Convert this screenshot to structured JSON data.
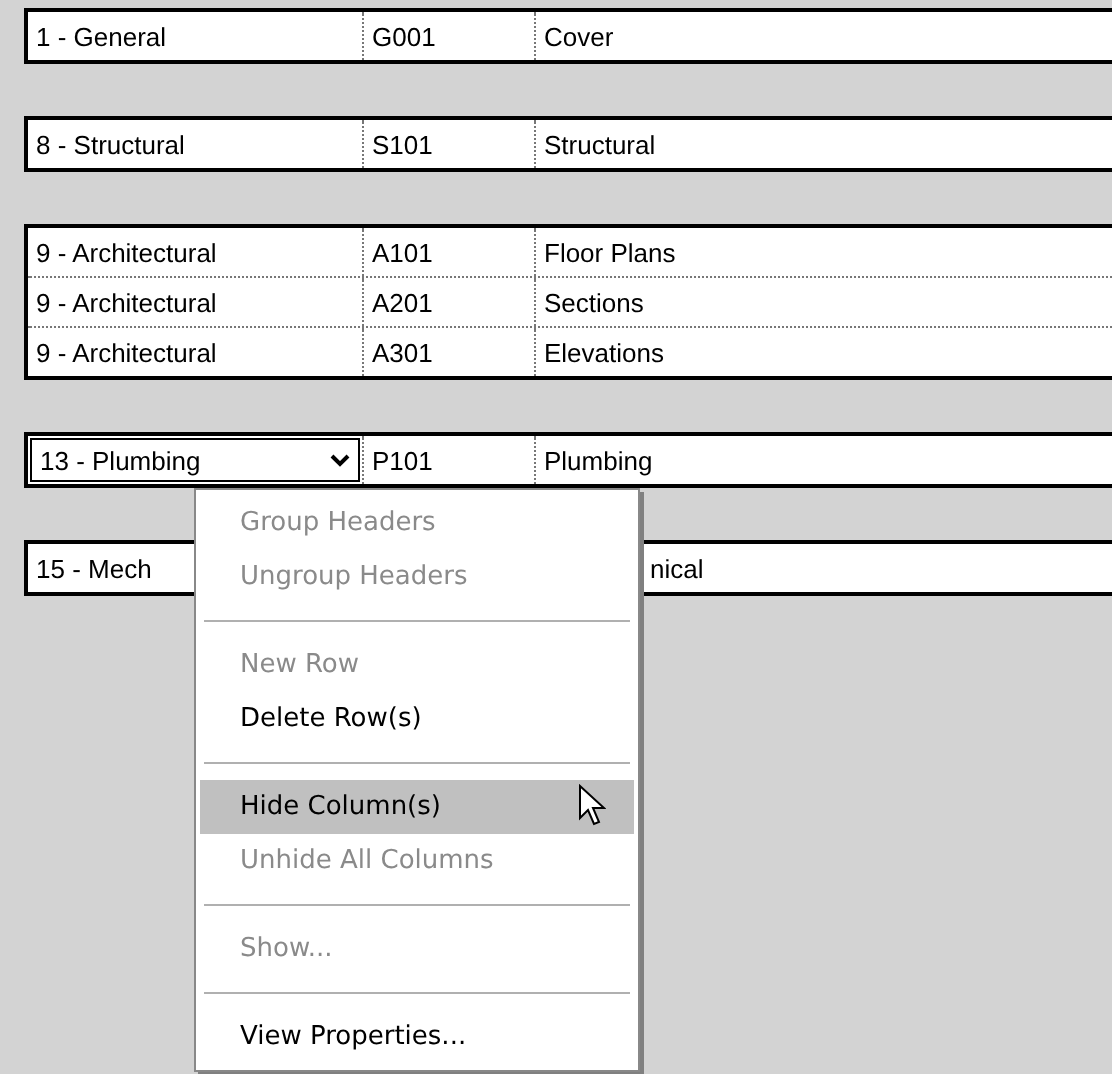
{
  "groups": [
    {
      "rows": [
        {
          "cells": [
            "1 - General",
            "G001",
            "Cover"
          ],
          "editing": false,
          "covered": false
        }
      ]
    },
    {
      "rows": [
        {
          "cells": [
            "8 - Structural",
            "S101",
            "Structural"
          ],
          "editing": false,
          "covered": false
        }
      ]
    },
    {
      "rows": [
        {
          "cells": [
            "9 - Architectural",
            "A101",
            "Floor Plans"
          ],
          "editing": false,
          "covered": false
        },
        {
          "cells": [
            "9 - Architectural",
            "A201",
            "Sections"
          ],
          "editing": false,
          "covered": false
        },
        {
          "cells": [
            "9 - Architectural",
            "A301",
            "Elevations"
          ],
          "editing": false,
          "covered": false
        }
      ]
    },
    {
      "rows": [
        {
          "cells": [
            "13 - Plumbing",
            "P101",
            "Plumbing"
          ],
          "editing": true,
          "covered": false
        }
      ]
    },
    {
      "rows": [
        {
          "cells": [
            "15 - Mech",
            null,
            "nical"
          ],
          "editing": false,
          "covered": true
        }
      ]
    }
  ],
  "context_menu": [
    {
      "kind": "item",
      "label": "Group Headers",
      "disabled": true,
      "selected": false
    },
    {
      "kind": "item",
      "label": "Ungroup Headers",
      "disabled": true,
      "selected": false
    },
    {
      "kind": "separator"
    },
    {
      "kind": "item",
      "label": "New Row",
      "disabled": true,
      "selected": false
    },
    {
      "kind": "item",
      "label": "Delete Row(s)",
      "disabled": false,
      "selected": false
    },
    {
      "kind": "separator"
    },
    {
      "kind": "item",
      "label": "Hide Column(s)",
      "disabled": false,
      "selected": true
    },
    {
      "kind": "item",
      "label": "Unhide All Columns",
      "disabled": true,
      "selected": false
    },
    {
      "kind": "separator"
    },
    {
      "kind": "item",
      "label": "Show...",
      "disabled": true,
      "selected": false
    },
    {
      "kind": "separator"
    },
    {
      "kind": "item",
      "label": "View Properties...",
      "disabled": false,
      "selected": false
    }
  ]
}
